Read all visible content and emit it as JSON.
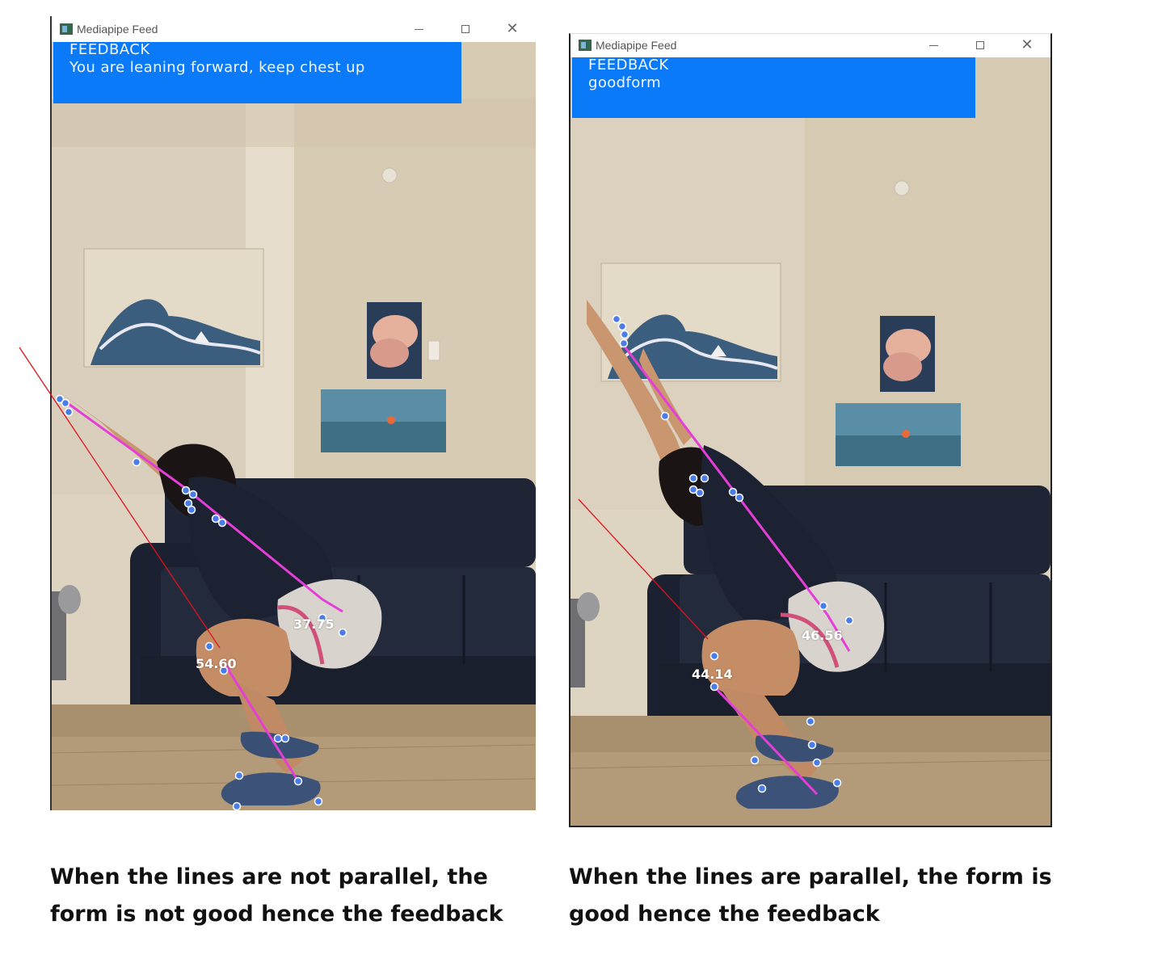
{
  "left_window": {
    "title": "Mediapipe Feed",
    "controls": {
      "minimize": "—",
      "maximize": "☐",
      "close": "✕"
    },
    "feedback": {
      "heading": "FEEDBACK",
      "message": "You are leaning forward, keep chest up"
    },
    "angles": {
      "hip": "37.75",
      "knee": "54.60"
    }
  },
  "right_window": {
    "title": "Mediapipe Feed",
    "controls": {
      "minimize": "—",
      "maximize": "☐",
      "close": "✕"
    },
    "feedback": {
      "heading": "FEEDBACK",
      "message": "goodform"
    },
    "angles": {
      "hip": "46.56",
      "knee": "44.14"
    }
  },
  "captions": {
    "left": "When the lines are not parallel, the form is not good hence the feedback",
    "right": "When the lines are parallel, the form is good hence the feedback"
  },
  "colors": {
    "feedback_bg": "#0a7af8",
    "pose_line": "#e53ed8",
    "landmark": "#4a7de8",
    "reference_line": "#e0121c"
  }
}
